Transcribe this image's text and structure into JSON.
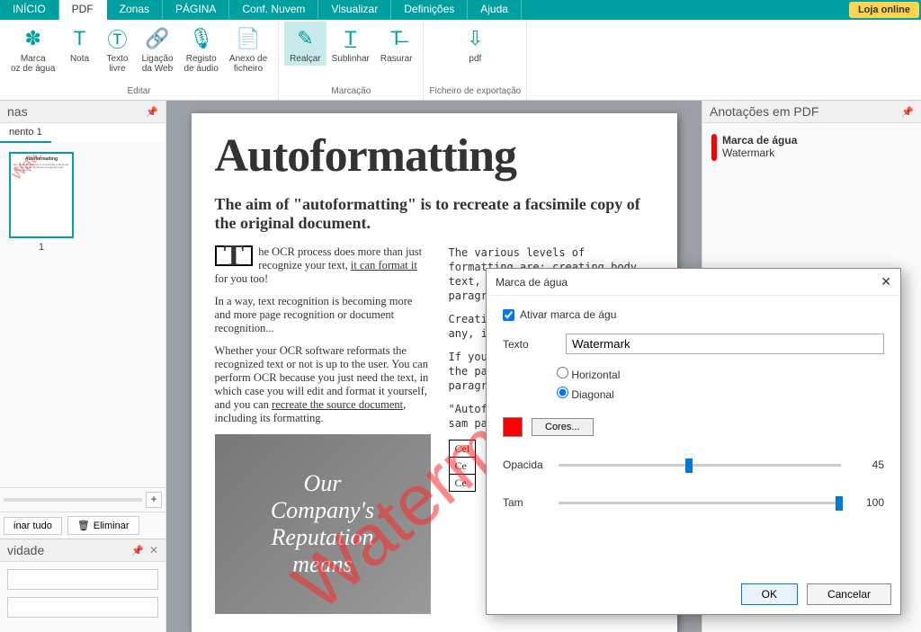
{
  "menubar": {
    "tabs": [
      "INÍCIO",
      "PDF",
      "Zonas",
      "PÁGINA",
      "Conf. Nuvem",
      "Visualizar",
      "Definições",
      "Ajuda"
    ],
    "active_index": 1,
    "shop": "Loja online"
  },
  "ribbon": {
    "groups": [
      {
        "label": "Editar",
        "buttons": [
          {
            "icon": "✽",
            "l1": "Marca",
            "l2": "oz de água"
          },
          {
            "icon": "T",
            "l1": "Nota",
            "l2": ""
          },
          {
            "icon": "Ⓣ",
            "l1": "Texto",
            "l2": "livre"
          },
          {
            "icon": "🔗",
            "l1": "Ligação",
            "l2": "da Web"
          },
          {
            "icon": "🎙",
            "l1": "Registo",
            "l2": "de áudio"
          },
          {
            "icon": "📄",
            "l1": "Anexo de",
            "l2": "ficheiro"
          }
        ]
      },
      {
        "label": "Marcação",
        "buttons": [
          {
            "icon": "✎",
            "l1": "Realçar",
            "l2": "",
            "active": true
          },
          {
            "icon": "T̲",
            "l1": "Sublinhar",
            "l2": ""
          },
          {
            "icon": "T̶",
            "l1": "Rasurar",
            "l2": ""
          }
        ]
      },
      {
        "label": "Ficheiro de exportação",
        "buttons": [
          {
            "icon": "⇩",
            "l1": "pdf",
            "l2": ""
          }
        ]
      }
    ]
  },
  "left": {
    "pages_title": "nas",
    "doc_tab": "nento 1",
    "thumb_num": "1",
    "delete_all": "inar tudo",
    "delete": "Eliminar",
    "activity_title": "vidade"
  },
  "document": {
    "title": "Autoformatting",
    "subtitle": "The aim of \"autoformatting\" is to recreate a facsimile copy of the original document.",
    "drop": "T",
    "p1a": "he OCR process does more than just recognize your text, ",
    "p1b": "it can format it",
    "p1c": " for you too!",
    "p2": "In a way, text recognition is becoming more and more page recognition or document recognition...",
    "p3a": "Whether your OCR software reformats the recognized text or not is up to the user. You can perform OCR because you just need the text, in which case you will edit and format it yourself, and you can ",
    "p3b": "recreate the source document",
    "p3c": ", including its formatting.",
    "col2a": "The various levels of formatting are: creating body text, retaining the word and paragraph creating",
    "col2b": "Creating format get a text. any, i the us",
    "col2c": "If you ret the font t across the paragraph are captur the paragr",
    "col2d": "\"Autofo copy of blocks, g the sam paragrapl across thi",
    "imgline1": "Our",
    "imgline2": "Company's",
    "imgline3": "Reputation",
    "imgline4": "means",
    "tbl": [
      "Cel",
      "Ce",
      "Ce"
    ],
    "watermark": "Watermark"
  },
  "right": {
    "title": "Anotações em PDF",
    "annot_title": "Marca de água",
    "annot_sub": "Watermark"
  },
  "dialog": {
    "title": "Marca de água",
    "activate": "Ativar marca de águ",
    "text_label": "Texto",
    "text_value": "Watermark",
    "horiz": "Horizontal",
    "diag": "Diagonal",
    "colors": "Cores...",
    "opacity_label": "Opacida",
    "opacity_value": "45",
    "size_label": "Tam",
    "size_value": "100",
    "ok": "OK",
    "cancel": "Cancelar",
    "swatch_color": "#ff0000"
  }
}
